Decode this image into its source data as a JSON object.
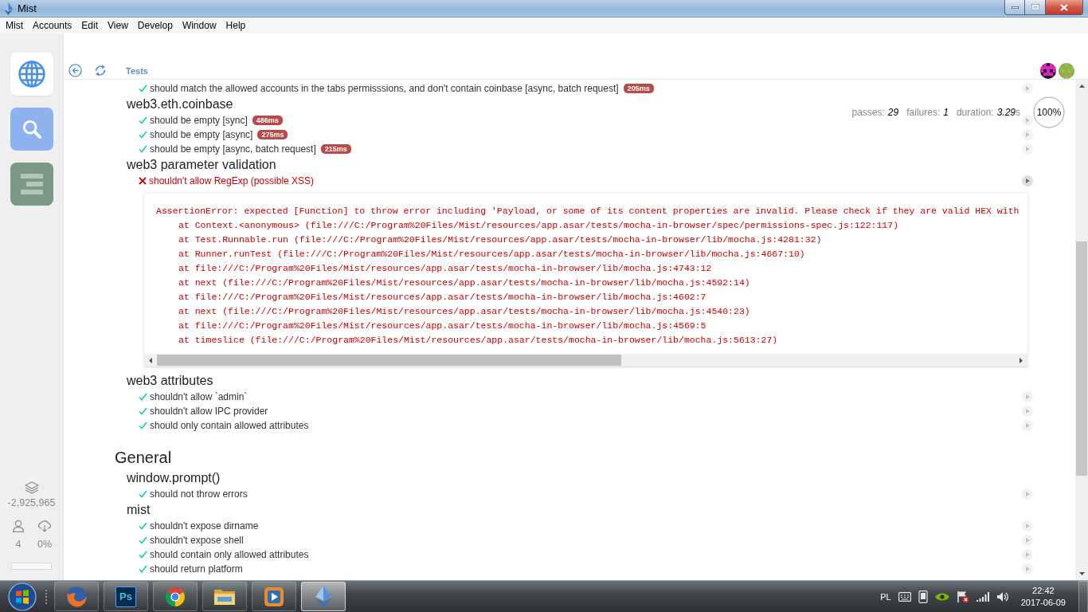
{
  "window": {
    "title": "Mist"
  },
  "menu": [
    "Mist",
    "Accounts",
    "Edit",
    "View",
    "Develop",
    "Window",
    "Help"
  ],
  "sidebar": {
    "tabs": [
      {
        "kind": "browser",
        "selected": true,
        "color": "#4a8fe0"
      },
      {
        "kind": "search",
        "selected": false,
        "color": "#8db2ee"
      },
      {
        "kind": "app",
        "selected": false,
        "color": "#7b9983"
      }
    ],
    "block": "-2,925,965",
    "peers": "4",
    "sync": "0%"
  },
  "browser": {
    "title": "Tests"
  },
  "report": {
    "stats": [
      {
        "label": "passes:",
        "value": "29"
      },
      {
        "label": "failures:",
        "value": "1"
      },
      {
        "label": "duration:",
        "value": "3.29",
        "unit": "s"
      }
    ],
    "progress": {
      "label": "100%",
      "level": 1
    },
    "suites": [
      {
        "kind": "suite",
        "children": [
          {
            "kind": "suite",
            "children": [
              {
                "kind": "test",
                "title": "should match the allowed accounts in the tabs permisssions, and don't contain coinbase [async, batch request]",
                "passed": true,
                "duration": "205ms",
                "slow": true
              }
            ]
          },
          {
            "kind": "suite",
            "title": "web3.eth.coinbase",
            "children": [
              {
                "kind": "test",
                "title": "should be empty [sync]",
                "passed": true,
                "duration": "486ms",
                "slow": true
              },
              {
                "kind": "test",
                "title": "should be empty [async]",
                "passed": true,
                "duration": "275ms",
                "slow": true
              },
              {
                "kind": "test",
                "title": "should be empty [async, batch request]",
                "passed": true,
                "duration": "215ms",
                "slow": true
              }
            ]
          },
          {
            "kind": "suite",
            "title": "web3 parameter validation",
            "children": [
              {
                "kind": "test",
                "title": "shouldn't allow RegExp (possible XSS)",
                "passed": false,
                "error": {
                  "message": "AssertionError: expected [Function] to throw error including 'Payload, or some of its content properties are invalid. Please check if they are valid HEX with",
                  "stack": [
                    "at Context.<anonymous> (file:///C:/Program%20Files/Mist/resources/app.asar/tests/mocha-in-browser/spec/permissions-spec.js:122:117)",
                    "at Test.Runnable.run (file:///C:/Program%20Files/Mist/resources/app.asar/tests/mocha-in-browser/lib/mocha.js:4281:32)",
                    "at Runner.runTest (file:///C:/Program%20Files/Mist/resources/app.asar/tests/mocha-in-browser/lib/mocha.js:4667:10)",
                    "at file:///C:/Program%20Files/Mist/resources/app.asar/tests/mocha-in-browser/lib/mocha.js:4743:12",
                    "at next (file:///C:/Program%20Files/Mist/resources/app.asar/tests/mocha-in-browser/lib/mocha.js:4592:14)",
                    "at file:///C:/Program%20Files/Mist/resources/app.asar/tests/mocha-in-browser/lib/mocha.js:4602:7",
                    "at next (file:///C:/Program%20Files/Mist/resources/app.asar/tests/mocha-in-browser/lib/mocha.js:4540:23)",
                    "at file:///C:/Program%20Files/Mist/resources/app.asar/tests/mocha-in-browser/lib/mocha.js:4569:5",
                    "at timeslice (file:///C:/Program%20Files/Mist/resources/app.asar/tests/mocha-in-browser/lib/mocha.js:5613:27)"
                  ]
                }
              }
            ]
          },
          {
            "kind": "suite",
            "title": "web3 attributes",
            "children": [
              {
                "kind": "test",
                "title": "shouldn't allow `admin`",
                "passed": true
              },
              {
                "kind": "test",
                "title": "shouldn't allow IPC provider",
                "passed": true
              },
              {
                "kind": "test",
                "title": "should only contain allowed attributes",
                "passed": true
              }
            ]
          }
        ]
      },
      {
        "kind": "suite",
        "title": "General",
        "children": [
          {
            "kind": "suite",
            "title": "window.prompt()",
            "children": [
              {
                "kind": "test",
                "title": "should not throw errors",
                "passed": true
              }
            ]
          },
          {
            "kind": "suite",
            "title": "mist",
            "children": [
              {
                "kind": "test",
                "title": "shouldn't expose dirname",
                "passed": true
              },
              {
                "kind": "test",
                "title": "shouldn't expose shell",
                "passed": true
              },
              {
                "kind": "test",
                "title": "should contain only allowed attributes",
                "passed": true
              },
              {
                "kind": "test",
                "title": "should return platform",
                "passed": true
              }
            ]
          }
        ]
      }
    ]
  },
  "taskbar": {
    "apps": [
      {
        "kind": "fox",
        "active": false
      },
      {
        "kind": "ps",
        "label": "Ps",
        "active": false
      },
      {
        "kind": "ring",
        "active": false
      },
      {
        "kind": "folder",
        "active": false
      },
      {
        "kind": "player",
        "active": false
      },
      {
        "kind": "diamond",
        "active": true
      }
    ],
    "language": "PL",
    "time": "22:42",
    "date": "2017-06-09"
  }
}
